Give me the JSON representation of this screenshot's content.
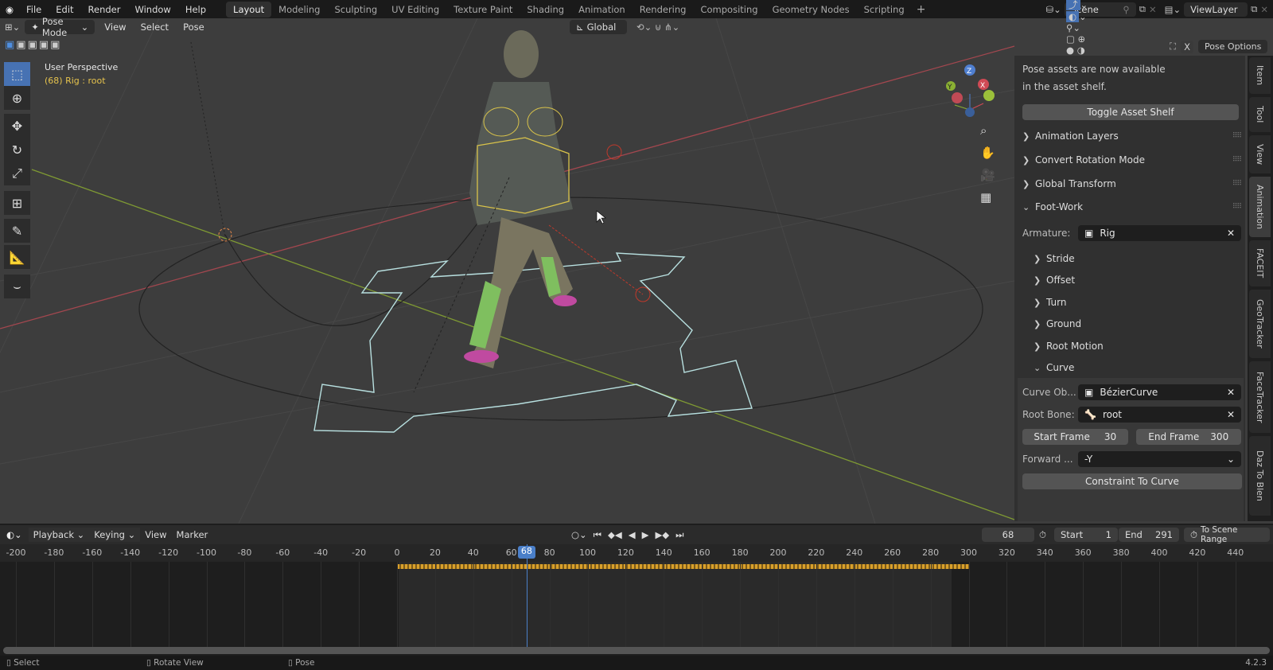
{
  "menu": [
    "File",
    "Edit",
    "Render",
    "Window",
    "Help"
  ],
  "workspaces": [
    "Layout",
    "Modeling",
    "Sculpting",
    "UV Editing",
    "Texture Paint",
    "Shading",
    "Animation",
    "Rendering",
    "Compositing",
    "Geometry Nodes",
    "Scripting"
  ],
  "scene": "Scene",
  "view_layer": "ViewLayer",
  "viewport": {
    "mode": "Pose Mode",
    "menus": [
      "View",
      "Select",
      "Pose"
    ],
    "orientation": "Global",
    "pose_options": "Pose Options",
    "x_toggle": "X",
    "perspective": "User Perspective",
    "object_info": "(68) Rig : root"
  },
  "panel": {
    "notice_line1": "Pose assets are now available",
    "notice_line2": "in the asset shelf.",
    "toggle_asset_shelf": "Toggle Asset Shelf",
    "sections": [
      "Animation Layers",
      "Convert Rotation Mode",
      "Global Transform",
      "Foot-Work"
    ],
    "armature_label": "Armature:",
    "armature_value": "Rig",
    "subsections": [
      "Stride",
      "Offset",
      "Turn",
      "Ground",
      "Root Motion",
      "Curve"
    ],
    "curve_obj_label": "Curve Ob...",
    "curve_obj_value": "BézierCurve",
    "root_bone_label": "Root Bone:",
    "root_bone_value": "root",
    "start_frame_label": "Start Frame",
    "start_frame_value": "30",
    "end_frame_label": "End Frame",
    "end_frame_value": "300",
    "forward_label": "Forward ...",
    "forward_value": "-Y",
    "constraint_button": "Constraint To Curve"
  },
  "side_tabs": [
    "Item",
    "Tool",
    "View",
    "Animation",
    "FACEIT",
    "GeoTracker",
    "FaceTracker",
    "Daz To Blen"
  ],
  "timeline": {
    "menus": [
      "Playback",
      "Keying",
      "View",
      "Marker"
    ],
    "current_frame": "68",
    "start_label": "Start",
    "start": "1",
    "end_label": "End",
    "end": "291",
    "scene_range": "To Scene Range",
    "ticks": [
      -200,
      -180,
      -160,
      -140,
      -120,
      -100,
      -80,
      -60,
      -40,
      -20,
      0,
      20,
      40,
      60,
      80,
      100,
      120,
      140,
      160,
      180,
      200,
      220,
      240,
      260,
      280,
      300,
      320,
      340,
      360,
      380,
      400,
      420,
      440
    ],
    "key_range": [
      0,
      300
    ]
  },
  "status": {
    "select": "Select",
    "rotate": "Rotate View",
    "pose": "Pose",
    "version": "4.2.3"
  },
  "colors": {
    "accent": "#4772b3",
    "playhead": "#4a7fc9",
    "keyframe": "#d9a02b"
  }
}
